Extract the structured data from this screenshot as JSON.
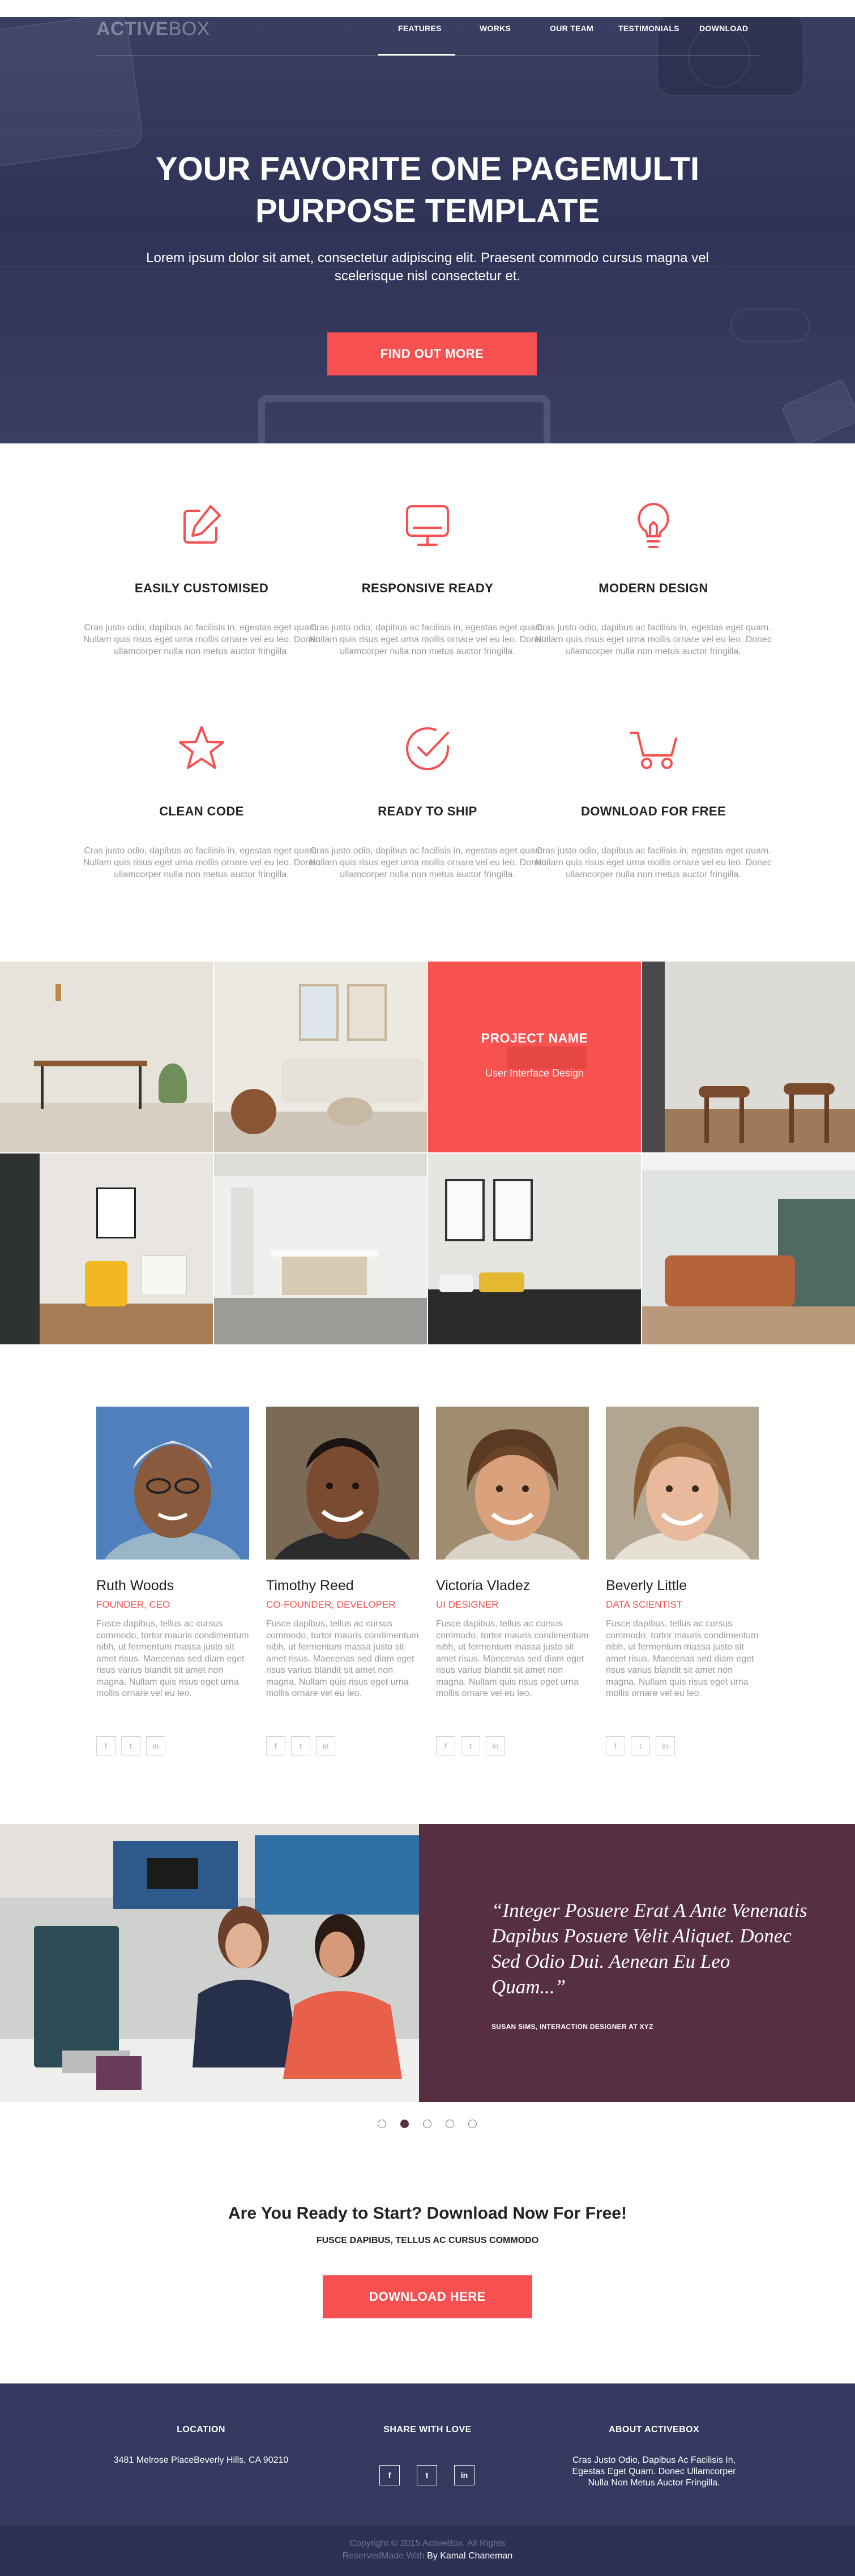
{
  "header": {
    "brand_bold": "ACTIVE",
    "brand_light": "BOX",
    "nav": [
      "FEATURES",
      "WORKS",
      "OUR TEAM",
      "TESTIMONIALS",
      "DOWNLOAD"
    ],
    "active_nav": "FEATURES"
  },
  "hero": {
    "title_line1": "YOUR FAVORITE ONE PAGEMULTI",
    "title_line2": "PURPOSE TEMPLATE",
    "subtitle": "Lorem ipsum dolor sit amet, consectetur adipiscing elit. Praesent commodo cursus magna vel scelerisque nisl consectetur et.",
    "button": "FIND OUT MORE"
  },
  "features": [
    {
      "icon": "edit-icon",
      "title": "EASILY CUSTOMISED",
      "text": "Cras justo odio, dapibus ac facilisis in, egestas eget quam. Nullam quis risus eget urna mollis ornare vel eu leo. Donec ullamcorper nulla non metus auctor fringilla."
    },
    {
      "icon": "monitor-icon",
      "title": "RESPONSIVE READY",
      "text": "Cras justo odio, dapibus ac facilisis in, egestas eget quam. Nullam quis risus eget urna mollis ornare vel eu leo. Donec ullamcorper nulla non metus auctor fringilla."
    },
    {
      "icon": "lightbulb-icon",
      "title": "MODERN DESIGN",
      "text": "Cras justo odio, dapibus ac facilisis in, egestas eget quam. Nullam quis risus eget urna mollis ornare vel eu leo. Donec ullamcorper nulla non metus auctor fringilla."
    },
    {
      "icon": "star-icon",
      "title": "CLEAN CODE",
      "text": "Cras justo odio, dapibus ac facilisis in, egestas eget quam. Nullam quis risus eget urna mollis ornare vel eu leo. Donec ullamcorper nulla non metus auctor fringilla."
    },
    {
      "icon": "check-circle-icon",
      "title": "READY TO SHIP",
      "text": "Cras justo odio, dapibus ac facilisis in, egestas eget quam. Nullam quis risus eget urna mollis ornare vel eu leo. Donec ullamcorper nulla non metus auctor fringilla."
    },
    {
      "icon": "cart-icon",
      "title": "DOWNLOAD FOR FREE",
      "text": "Cras justo odio, dapibus ac facilisis in, egestas eget quam. Nullam quis risus eget urna mollis ornare vel eu leo. Donec ullamcorper nulla non metus auctor fringilla."
    }
  ],
  "portfolio": {
    "overlay_title": "PROJECT NAME",
    "overlay_subtitle": "User Interface Design"
  },
  "team": [
    {
      "name": "Ruth Woods",
      "role": "FOUNDER, CEO",
      "bio": "Fusce dapibus, tellus ac cursus commodo, tortor mauris condimentum nibh, ut fermentum massa justo sit amet risus. Maecenas sed diam eget risus varius blandit sit amet non magna. Nullam quis risus eget urna mollis ornare vel eu leo."
    },
    {
      "name": "Timothy Reed",
      "role": "CO-FOUNDER, DEVELOPER",
      "bio": "Fusce dapibus, tellus ac cursus commodo, tortor mauris condimentum nibh, ut fermentum massa justo sit amet risus. Maecenas sed diam eget risus varius blandit sit amet non magna. Nullam quis risus eget urna mollis ornare vel eu leo."
    },
    {
      "name": "Victoria Vladez",
      "role": "UI DESIGNER",
      "bio": "Fusce dapibus, tellus ac cursus commodo, tortor mauris condimentum nibh, ut fermentum massa justo sit amet risus. Maecenas sed diam eget risus varius blandit sit amet non magna. Nullam quis risus eget urna mollis ornare vel eu leo."
    },
    {
      "name": "Beverly Little",
      "role": "DATA SCIENTIST",
      "bio": "Fusce dapibus, tellus ac cursus commodo, tortor mauris condimentum nibh, ut fermentum massa justo sit amet risus. Maecenas sed diam eget risus varius blandit sit amet non magna. Nullam quis risus eget urna mollis ornare vel eu leo."
    }
  ],
  "social_glyphs": {
    "facebook": "f",
    "twitter": "t",
    "linkedin": "in"
  },
  "testimonial": {
    "quote": "“Integer Posuere Erat A Ante Venenatis Dapibus Posuere Velit Aliquet. Donec Sed Odio Dui. Aenean Eu Leo Quam...”",
    "author": "SUSAN SIMS, INTERACTION DESIGNER AT XYZ",
    "slide_count": 5,
    "active_slide": 2
  },
  "cta": {
    "title": "Are You Ready to Start? Download Now For Free!",
    "subtitle": "FUSCE DAPIBUS, TELLUS AC CURSUS COMMODO",
    "button": "DOWNLOAD HERE"
  },
  "footer": {
    "location_title": "LOCATION",
    "location_text": "3481 Melrose PlaceBeverly Hills, CA 90210",
    "share_title": "SHARE WITH LOVE",
    "about_title": "ABOUT ACTIVEBOX",
    "about_text_1": "Cras Justo Odio, Dapibus Ac Facilisis In,",
    "about_text_2": "Egestas Eget Quam. Donec Ullamcorper",
    "about_text_3": "Nulla Non Metus Auctor Fringilla.",
    "copyright_1": "Copyright © 2015 ActiveBox. All Rights",
    "copyright_2a": "ReservedMade With ",
    "copyright_2b": "By Kamal Chaneman"
  },
  "colors": {
    "accent": "#f65050",
    "hero_bg": "#33375b",
    "testimonial_bg": "#572f42",
    "footer_bg": "#343960",
    "bottom_bg": "#2c3052"
  }
}
